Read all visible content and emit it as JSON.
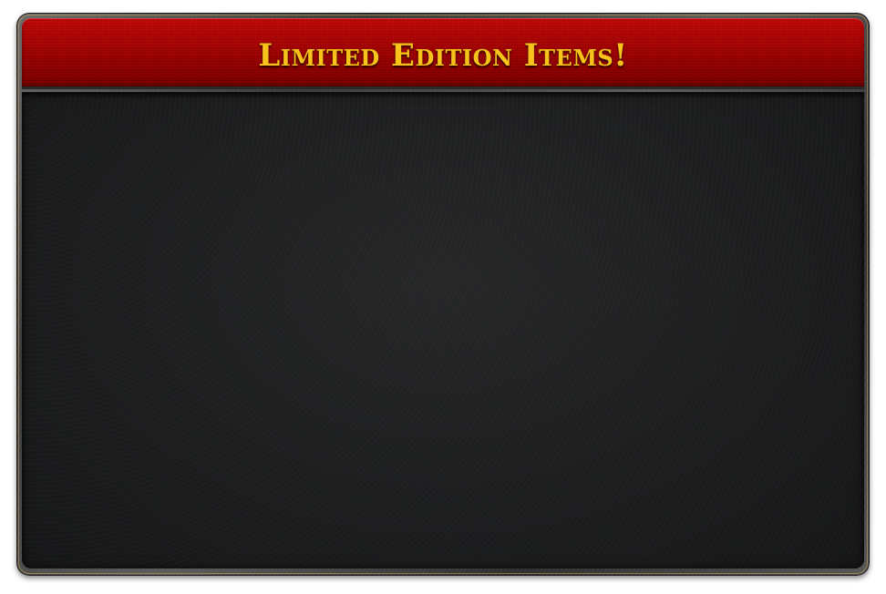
{
  "window": {
    "title": "Limited Edition Items!"
  },
  "colors": {
    "header_red": "#a80404",
    "title_gold": "#f7c21a",
    "panel_dark": "#1c1d1e",
    "frame_border": "#c9a45a"
  }
}
